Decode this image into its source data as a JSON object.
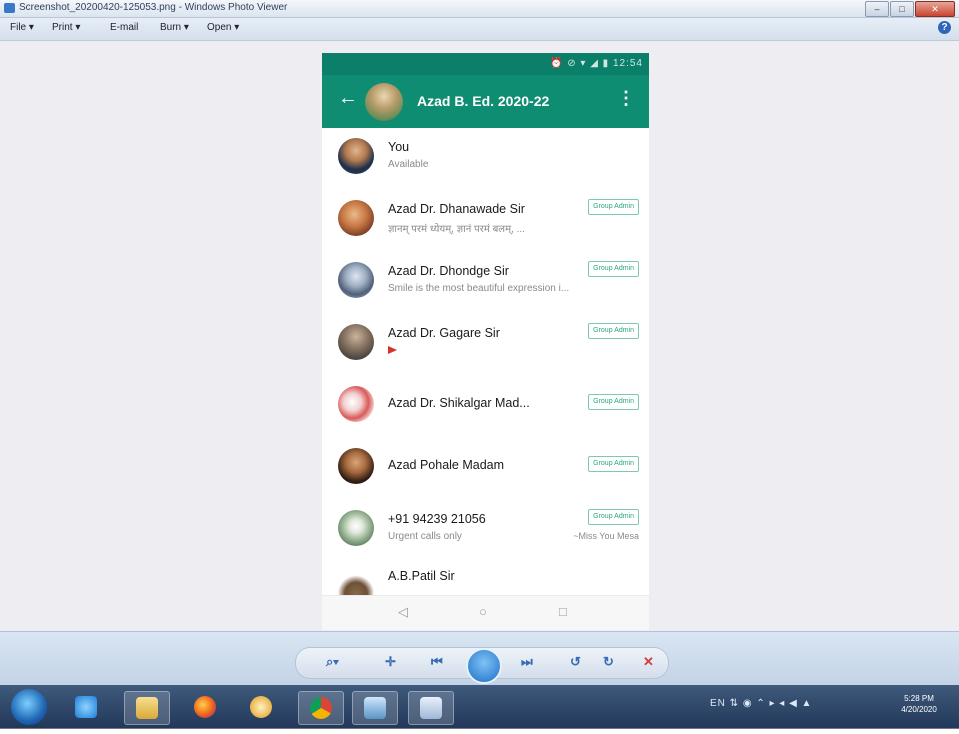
{
  "window": {
    "title": "Screenshot_20200420-125053.png - Windows Photo Viewer",
    "buttons": {
      "minimize": "–",
      "maximize": "□",
      "close": "✕"
    }
  },
  "menubar": {
    "file": "File ▾",
    "print": "Print ▾",
    "email": "E-mail",
    "burn": "Burn ▾",
    "open": "Open ▾",
    "help": "?"
  },
  "phone": {
    "status_icons": "⏰ ⊘ ▾ ◢ ▮ 12:54",
    "header": {
      "back": "←",
      "group_name": "Azad B. Ed. 2020-22",
      "more": "⋮"
    },
    "participants": [
      {
        "name": "You",
        "status": "Available",
        "badge": "",
        "extra": "",
        "avatar_color": "#3d4d66"
      },
      {
        "name": "Azad Dr. Dhanawade Sir",
        "status": "ज्ञानम् परमं ध्येयम्, ज्ञानं परमं बलम्, ...",
        "badge": "Group Admin",
        "extra": "",
        "avatar_color": "#c97a45"
      },
      {
        "name": "Azad Dr. Dhondge Sir",
        "status": "Smile is the most beautiful expression i...",
        "badge": "Group Admin",
        "extra": "",
        "avatar_color": "#7d8fa6"
      },
      {
        "name": "Azad Dr. Gagare Sir",
        "status": "",
        "badge": "Group Admin",
        "extra": "",
        "avatar_color": "#6b6058"
      },
      {
        "name": "Azad Dr. Shikalgar Mad...",
        "status": "",
        "badge": "Group Admin",
        "extra": "",
        "avatar_color": "#d86a6a"
      },
      {
        "name": "Azad Pohale Madam",
        "status": "",
        "badge": "Group Admin",
        "extra": "",
        "avatar_color": "#5a4030"
      },
      {
        "name": "+91 94239 21056",
        "status": "Urgent calls only",
        "badge": "Group Admin",
        "extra": "~Miss You Mesa",
        "avatar_color": "#8fae8c"
      },
      {
        "name": "A.B.Patil Sir",
        "status": "",
        "badge": "",
        "extra": "",
        "avatar_color": "#8a6a4a"
      }
    ],
    "nav": {
      "back": "◁",
      "home": "○",
      "recent": "□"
    }
  },
  "controls": {
    "zoom": "⌕▾",
    "actual": "✛",
    "prev": "⏮",
    "next": "⏭",
    "rotate_ccw": "↺",
    "rotate_cw": "↻",
    "delete": "✕"
  },
  "taskbar": {
    "tray": "EN ⇅ ◉ ⌃ ▸ ◂ ◀ ▲",
    "time": "5:28 PM",
    "date": "4/20/2020"
  }
}
